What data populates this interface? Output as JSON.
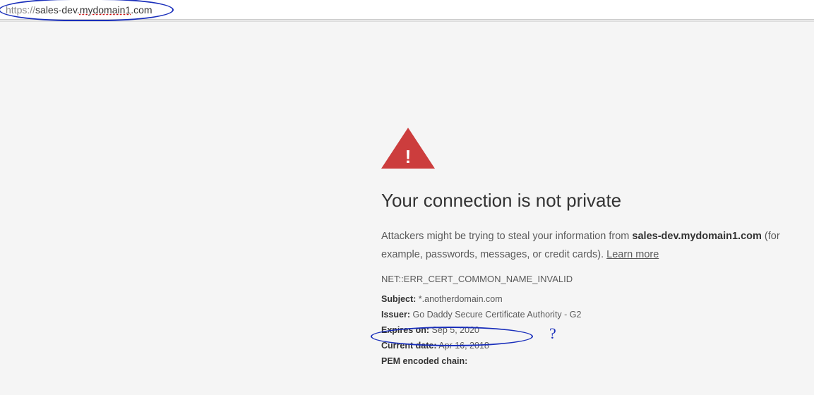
{
  "address_bar": {
    "protocol": "https://",
    "host_prefix": "sales-dev.",
    "host_main": "mydomain1",
    "host_suffix": ".com"
  },
  "warning": {
    "title": "Your connection is not private",
    "explain_prefix": "Attackers might be trying to steal your information from ",
    "explain_host": "sales-dev.mydomain1.com",
    "explain_suffix": " (for example, passwords, messages, or credit cards). ",
    "learn_more": "Learn more",
    "error_code": "NET::ERR_CERT_COMMON_NAME_INVALID"
  },
  "cert": {
    "subject_label": "Subject:",
    "subject_value": " *.anotherdomain.com",
    "issuer_label": "Issuer:",
    "issuer_value": " Go Daddy Secure Certificate Authority - G2",
    "expires_label": "Expires on:",
    "expires_value": " Sep 5, 2020",
    "current_label": "Current date:",
    "current_value": " Apr 16, 2018",
    "pem_label": "PEM encoded chain:"
  },
  "annotations": {
    "question_mark": "?"
  }
}
